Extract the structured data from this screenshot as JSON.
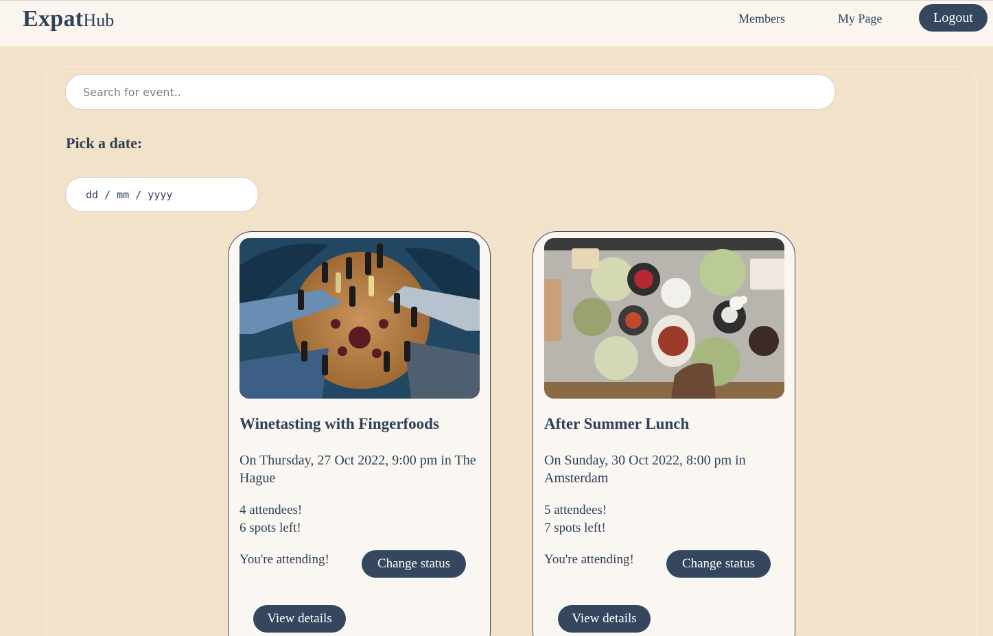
{
  "header": {
    "brand_bold": "Expat",
    "brand_rest": "Hub",
    "nav": {
      "members": "Members",
      "my_page": "My Page",
      "logout": "Logout"
    }
  },
  "search": {
    "placeholder": "Search for event.."
  },
  "date_filter": {
    "label": "Pick a date:",
    "placeholder": "dd / mm / yyyy"
  },
  "events": [
    {
      "title": "Winetasting with Fingerfoods",
      "when": "On Thursday, 27 Oct 2022, 9:00 pm in The Hague",
      "attendees": "4 attendees!",
      "spots": "6 spots left!",
      "status": "You're attending!",
      "change_label": "Change status",
      "details_label": "View details"
    },
    {
      "title": "After Summer Lunch",
      "when": "On Sunday, 30 Oct 2022, 8:00 pm in Amsterdam",
      "attendees": "5 attendees!",
      "spots": "7 spots left!",
      "status": "You're attending!",
      "change_label": "Change status",
      "details_label": "View details"
    }
  ],
  "colors": {
    "page_bg": "#f2e2c9",
    "header_bg": "#faf5ef",
    "accent": "#34475f",
    "text": "#2f4058",
    "card_bg": "#faf6f1"
  }
}
